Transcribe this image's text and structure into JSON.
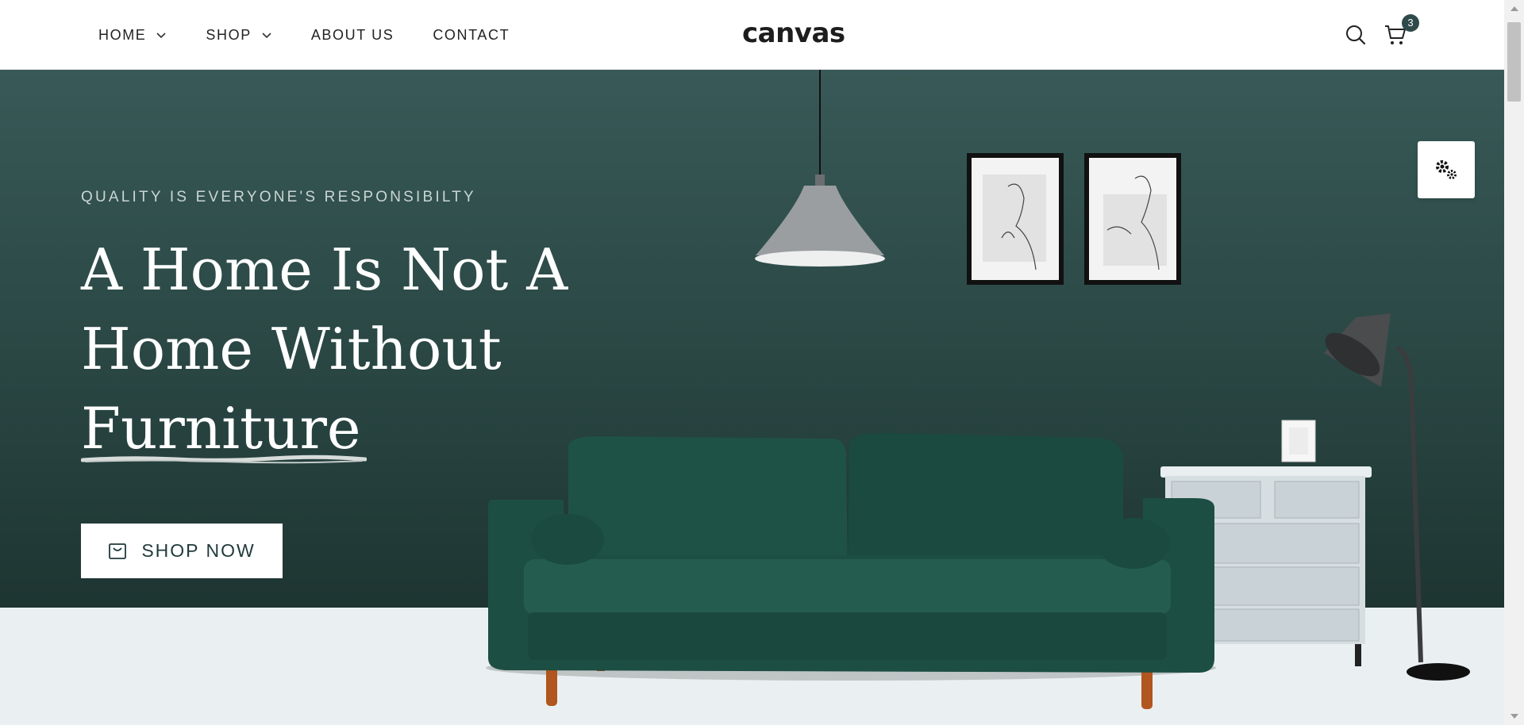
{
  "nav": {
    "items": [
      {
        "label": "HOME",
        "has_dropdown": true
      },
      {
        "label": "SHOP",
        "has_dropdown": true
      },
      {
        "label": "ABOUT US",
        "has_dropdown": false
      },
      {
        "label": "CONTACT",
        "has_dropdown": false
      }
    ]
  },
  "brand": {
    "logo": "canvas"
  },
  "header_icons": {
    "search": "search-icon",
    "cart": "cart-icon",
    "cart_count": "3"
  },
  "hero": {
    "kicker": "QUALITY IS EVERYONE'S RESPONSIBILTY",
    "headline_lines": [
      "A Home Is Not A",
      "Home Without",
      "Furniture"
    ],
    "cta_label": "SHOP NOW",
    "cta_icon": "bag-icon"
  },
  "settings_panel": {
    "icon": "gears-icon"
  },
  "colors": {
    "hero_bg": "#2c4a47",
    "floor": "#eaf0f1",
    "sofa": "#1e4f45",
    "badge": "#2f4a4a",
    "text_dark": "#1f3a3a"
  }
}
